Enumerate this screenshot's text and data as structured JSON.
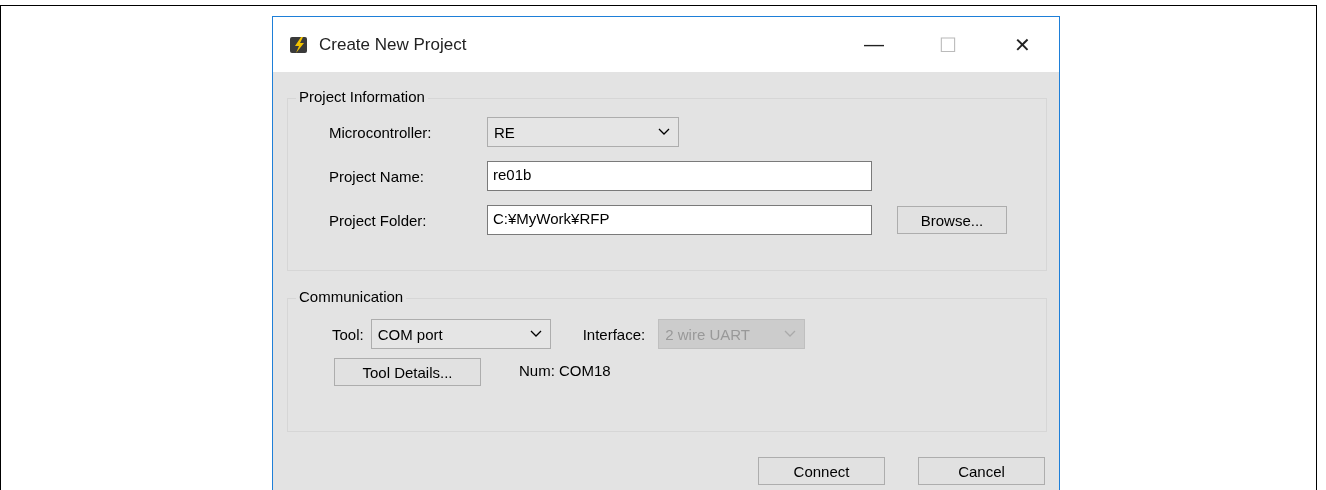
{
  "window": {
    "title": "Create New Project",
    "controls": [
      "—",
      "☐",
      "✕"
    ]
  },
  "project_information": {
    "title": "Project Information",
    "fields": [
      {
        "kind": "dropdown",
        "label": "Microcontroller:",
        "value": "RE",
        "disabled": false
      },
      {
        "kind": "text",
        "label": "Project Name:",
        "value": "re01b"
      },
      {
        "kind": "text",
        "label": "Project Folder:",
        "value": "C:¥MyWork¥RFP",
        "button": "Browse..."
      }
    ]
  },
  "communication": {
    "title": "Communication",
    "tool": {
      "label": "Tool:",
      "value": "COM port",
      "disabled": false
    },
    "interface": {
      "label": "Interface:",
      "value": "2 wire UART",
      "disabled": true
    },
    "tool_details_button": "Tool Details...",
    "num": "Num: COM18"
  },
  "buttons": [
    "Connect",
    "Cancel"
  ]
}
